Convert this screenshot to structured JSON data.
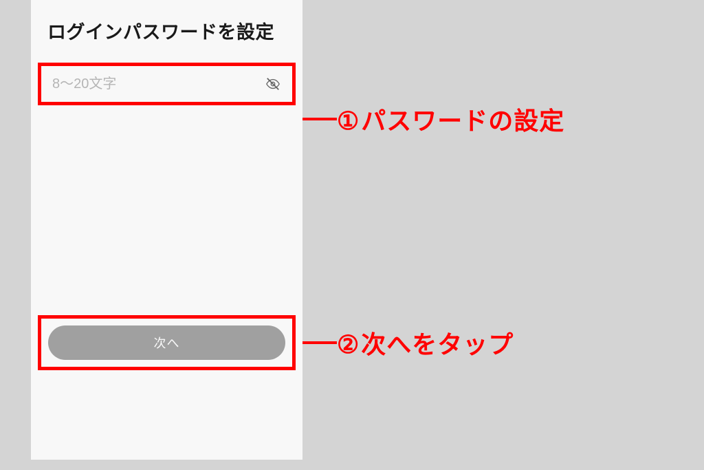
{
  "screen": {
    "title": "ログインパスワードを設定",
    "password": {
      "placeholder": "8〜20文字",
      "value": ""
    },
    "next_button": "次へ"
  },
  "annotations": {
    "step1": {
      "number": "①",
      "text": "パスワードの設定"
    },
    "step2": {
      "number": "②",
      "text": "次へをタップ"
    }
  },
  "colors": {
    "highlight": "#ff0000",
    "button_bg": "#a0a0a0",
    "background": "#d4d4d4"
  }
}
